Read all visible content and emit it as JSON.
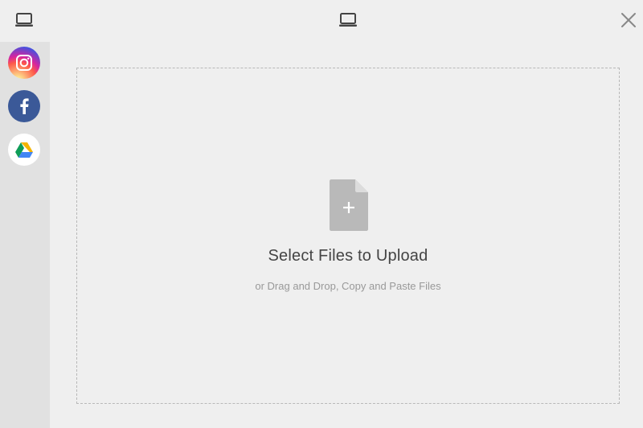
{
  "header": {
    "left_icon": "laptop-icon",
    "center_icon": "laptop-icon",
    "close_icon": "close-icon"
  },
  "sidebar": {
    "sources": [
      {
        "name": "instagram",
        "icon": "instagram-icon"
      },
      {
        "name": "facebook",
        "icon": "facebook-icon"
      },
      {
        "name": "google-drive",
        "icon": "google-drive-icon"
      }
    ]
  },
  "dropzone": {
    "title": "Select Files to Upload",
    "subtitle": "or Drag and Drop, Copy and Paste Files",
    "icon": "file-add-icon"
  },
  "colors": {
    "background": "#efefef",
    "sidebar": "#e1e1e1",
    "icon_gray": "#555555",
    "file_icon": "#b9b9b9",
    "facebook": "#3b5998"
  }
}
